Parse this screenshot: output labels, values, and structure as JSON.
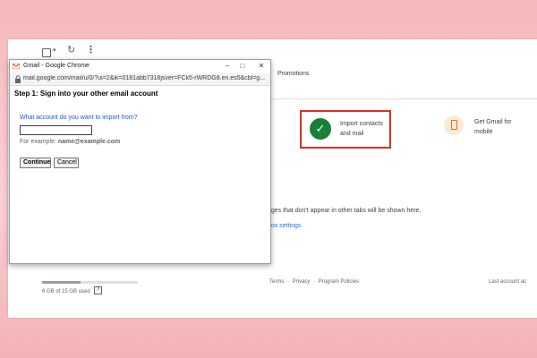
{
  "gmail": {
    "tabs": {
      "promotions": "Promotions"
    },
    "import_card": {
      "line1": "Import contacts",
      "line2": "and mail"
    },
    "mobile_card": {
      "line1": "Get Gmail for",
      "line2": "mobile"
    },
    "empty_state": {
      "dot": ".",
      "message": "ages that don't appear in other tabs will be shown here.",
      "settings_link": "box settings."
    },
    "storage": {
      "text": "6 GB of 15 GB used",
      "fraction": 0.4
    },
    "footer": {
      "terms": "Terms",
      "privacy": "Privacy",
      "policies": "Program Policies",
      "separator": "·"
    },
    "last_activity": "Last account ac"
  },
  "popup": {
    "window_title": "Gmail - Google Chrome",
    "url": "mail.google.com/mail/u/0/?ui=2&ik=0181abb7318jsver=FCk5-rWRDG8.en.es5&cbl=g...",
    "heading": "Step 1: Sign into your other email account",
    "question": "What account do you want to import from?",
    "email_value": "",
    "example_prefix": "For example:",
    "example_email": "name@example.com",
    "continue_label": "Continue",
    "cancel_label": "Cancel",
    "controls": {
      "minimize": "–",
      "maximize": "□",
      "close": "✕"
    }
  },
  "icons": {
    "check": "✓",
    "refresh": "↻",
    "more": "⋮",
    "caret": "▾",
    "external": "↗"
  },
  "colors": {
    "accent_red": "#d93025",
    "success_green": "#188038",
    "link_blue": "#1a73e8"
  }
}
